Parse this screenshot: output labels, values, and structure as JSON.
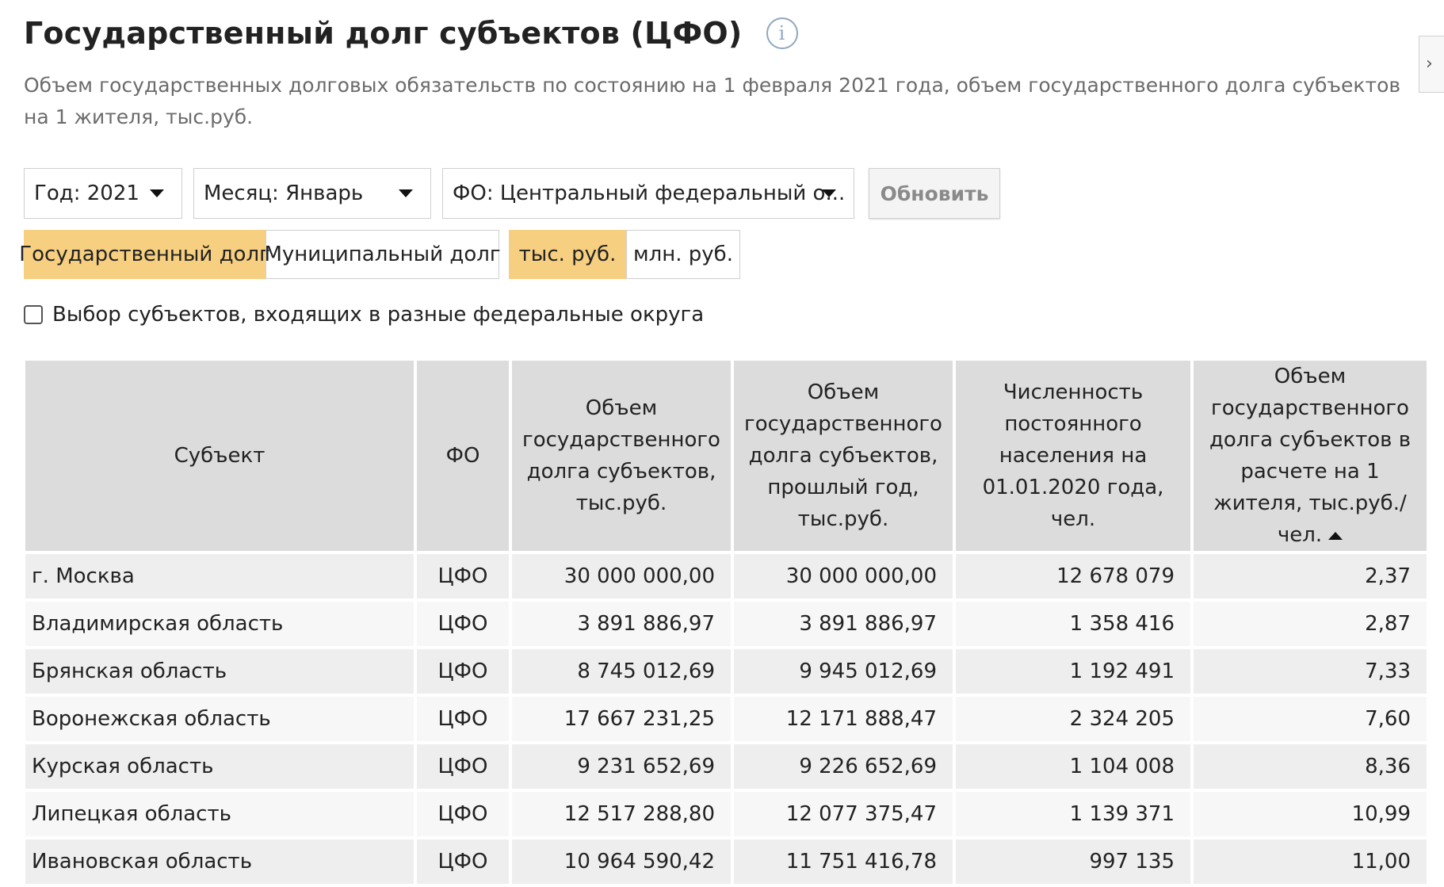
{
  "header": {
    "title": "Государственный долг субъектов (ЦФО)",
    "info_icon": "info-icon",
    "subtitle": "Объем государственных долговых обязательств по состоянию на 1 февраля 2021 года, объем государственного долга субъектов на 1 жителя, тыс.руб."
  },
  "filters": {
    "year": "Год: 2021",
    "month": "Месяц: Январь",
    "district": "ФО: Центральный федеральный о...",
    "refresh_label": "Обновить"
  },
  "debt_type": {
    "options": [
      "Государственный долг",
      "Муниципальный долг"
    ],
    "selected": "Государственный долг"
  },
  "units": {
    "options": [
      "тыс. руб.",
      "млн. руб."
    ],
    "selected": "тыс. руб."
  },
  "checkbox": {
    "label": "Выбор субъектов, входящих в разные федеральные округа",
    "checked": false
  },
  "table": {
    "columns": [
      "Субъект",
      "ФО",
      "Объем государственного долга субъектов, тыс.руб.",
      "Объем государственного долга субъектов, прошлый год, тыс.руб.",
      "Численность постоянного населения на 01.01.2020 года, чел.",
      "Объем государственного долга субъектов в расчете на 1 жителя, тыс.руб./чел."
    ],
    "sorted_column": 5,
    "sort_direction": "ascending",
    "rows": [
      [
        "г. Москва",
        "ЦФО",
        "30 000 000,00",
        "30 000 000,00",
        "12 678 079",
        "2,37"
      ],
      [
        "Владимирская область",
        "ЦФО",
        "3 891 886,97",
        "3 891 886,97",
        "1 358 416",
        "2,87"
      ],
      [
        "Брянская область",
        "ЦФО",
        "8 745 012,69",
        "9 945 012,69",
        "1 192 491",
        "7,33"
      ],
      [
        "Воронежская область",
        "ЦФО",
        "17 667 231,25",
        "12 171 888,47",
        "2 324 205",
        "7,60"
      ],
      [
        "Курская область",
        "ЦФО",
        "9 231 652,69",
        "9 226 652,69",
        "1 104 008",
        "8,36"
      ],
      [
        "Липецкая область",
        "ЦФО",
        "12 517 288,80",
        "12 077 375,47",
        "1 139 371",
        "10,99"
      ],
      [
        "Ивановская область",
        "ЦФО",
        "10 964 590,42",
        "11 751 416,78",
        "997 135",
        "11,00"
      ]
    ]
  },
  "colors": {
    "active_toggle": "#f7cf80",
    "header_cell": "#dcdcdc",
    "row_odd": "#eeeeee",
    "row_even": "#f7f7f7",
    "info_icon": "#8fa7bf"
  }
}
